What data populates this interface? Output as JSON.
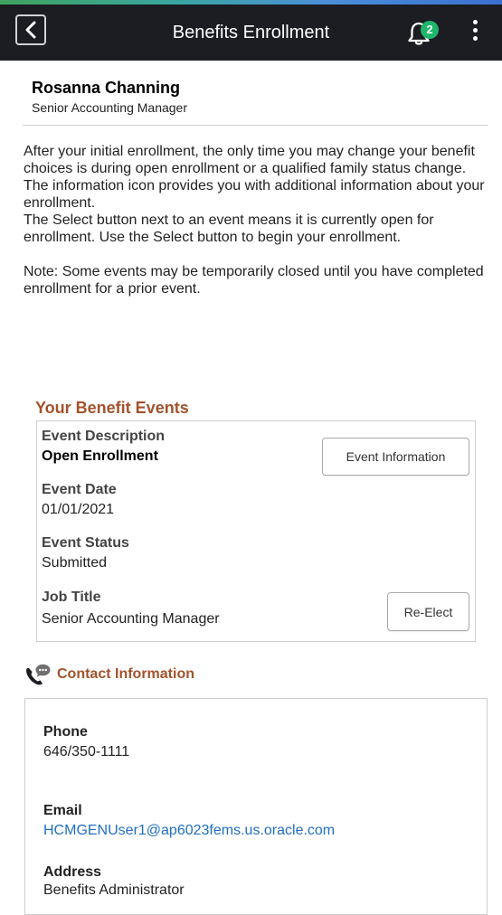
{
  "header": {
    "title": "Benefits Enrollment",
    "notification_count": "2",
    "accent_colors": [
      "#3ea35e",
      "#3aa6a0",
      "#4a8fd8",
      "#3b6fd1"
    ]
  },
  "person": {
    "name": "Rosanna Channing",
    "title": "Senior Accounting Manager"
  },
  "intro": {
    "lines": [
      "After your initial enrollment, the only time you may change your benefit choices is during open enrollment or a qualified family status change.",
      "The information icon provides you with additional information about your enrollment.",
      "The Select button next to an event means it is currently open for enrollment. Use the Select button to begin your enrollment."
    ],
    "note": "Note: Some events may be temporarily closed until you have completed enrollment for a prior event."
  },
  "events": {
    "heading": "Your Benefit Events",
    "event_description_label": "Event Description",
    "event_description_value": "Open Enrollment",
    "event_information_button": "Event Information",
    "event_date_label": "Event Date",
    "event_date_value": "01/01/2021",
    "event_status_label": "Event Status",
    "event_status_value": "Submitted",
    "job_title_label": "Job Title",
    "job_title_value": "Senior Accounting Manager",
    "re_elect_button": "Re-Elect"
  },
  "contact": {
    "heading": "Contact Information",
    "phone_label": "Phone",
    "phone_value": "646/350-1111",
    "email_label": "Email",
    "email_value": "HCMGENUser1@ap6023fems.us.oracle.com",
    "address_label": "Address",
    "address_value": "Benefits Administrator"
  },
  "colors": {
    "topbar": "#1b1d22",
    "section_heading": "#a3532c",
    "link": "#1f6fc7",
    "badge": "#1fb56b"
  }
}
